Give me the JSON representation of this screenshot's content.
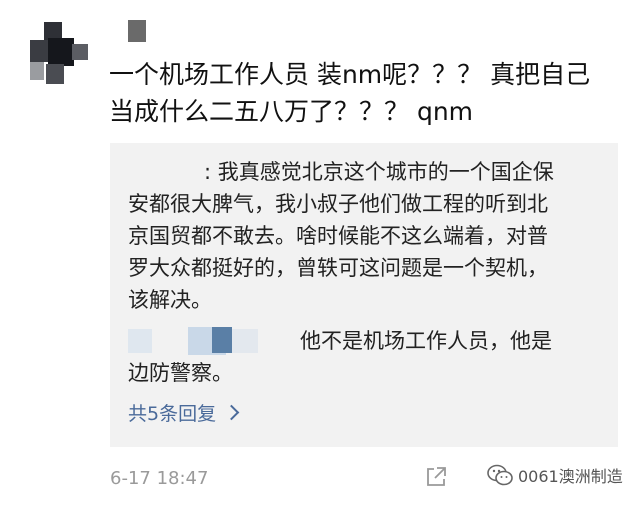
{
  "comment": {
    "text": "一个机场工作人员 装nm呢？？？ 真把自己\n当成什么二五八万了？？？ qnm"
  },
  "replies": [
    {
      "separator": ":",
      "text": " 我真感觉北京这个城市的一个国企保\n安都很大脾气，我小叔子他们做工程的听到北\n京国贸都不敢去。啥时候能不这么端着，对普\n罗大众都挺好的，曾轶可这问题是一个契机，\n该解决。"
    },
    {
      "text": "他不是机场工作人员，他是\n边防警察。"
    }
  ],
  "more_replies": {
    "label": "共5条回复"
  },
  "timestamp": "6-17 18:47",
  "watermark": {
    "text": "0061澳洲制造"
  },
  "colors": {
    "reply_bg": "#f2f2f2",
    "link": "#4a6a9a",
    "meta": "#9a9a9a"
  }
}
